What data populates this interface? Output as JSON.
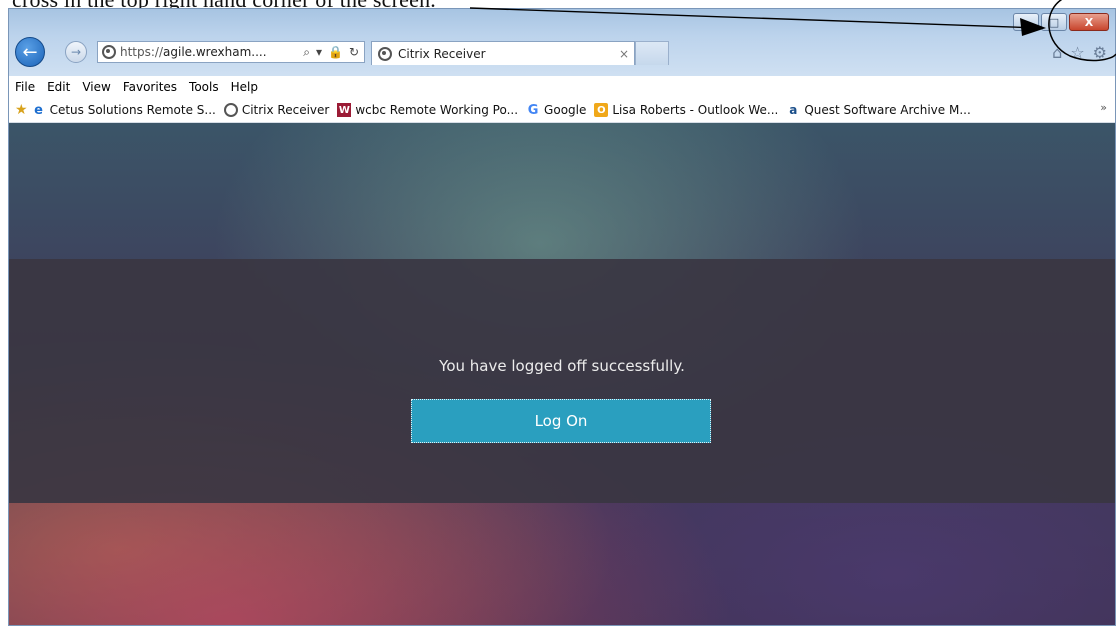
{
  "document_text": "cross in the top right hand corner of the screen.",
  "window_controls": {
    "minimize": "–",
    "maximize": "□",
    "close": "X"
  },
  "address_bar": {
    "protocol": "https://",
    "host": "agile.wrexham....",
    "search_symbol": "⌕",
    "dropdown": "▾",
    "lock": "🔒",
    "refresh": "↻"
  },
  "tab": {
    "title": "Citrix Receiver",
    "close": "×"
  },
  "menu": [
    "File",
    "Edit",
    "View",
    "Favorites",
    "Tools",
    "Help"
  ],
  "favorites": [
    {
      "label": "Cetus Solutions Remote S...",
      "icon": "ie-icon"
    },
    {
      "label": "Citrix Receiver",
      "icon": "citrix-icon"
    },
    {
      "label": "wcbc Remote Working Po...",
      "icon": "wcbc-icon"
    },
    {
      "label": "Google",
      "icon": "google-icon"
    },
    {
      "label": "Lisa Roberts - Outlook We...",
      "icon": "outlook-icon"
    },
    {
      "label": "Quest Software Archive M...",
      "icon": "quest-icon"
    }
  ],
  "favorites_overflow": "»",
  "page": {
    "message": "You have logged off successfully.",
    "logon_button": "Log On"
  },
  "colors": {
    "accent": "#2a9fbf",
    "close_button": "#c8452d",
    "back_button": "#1b63b8"
  }
}
